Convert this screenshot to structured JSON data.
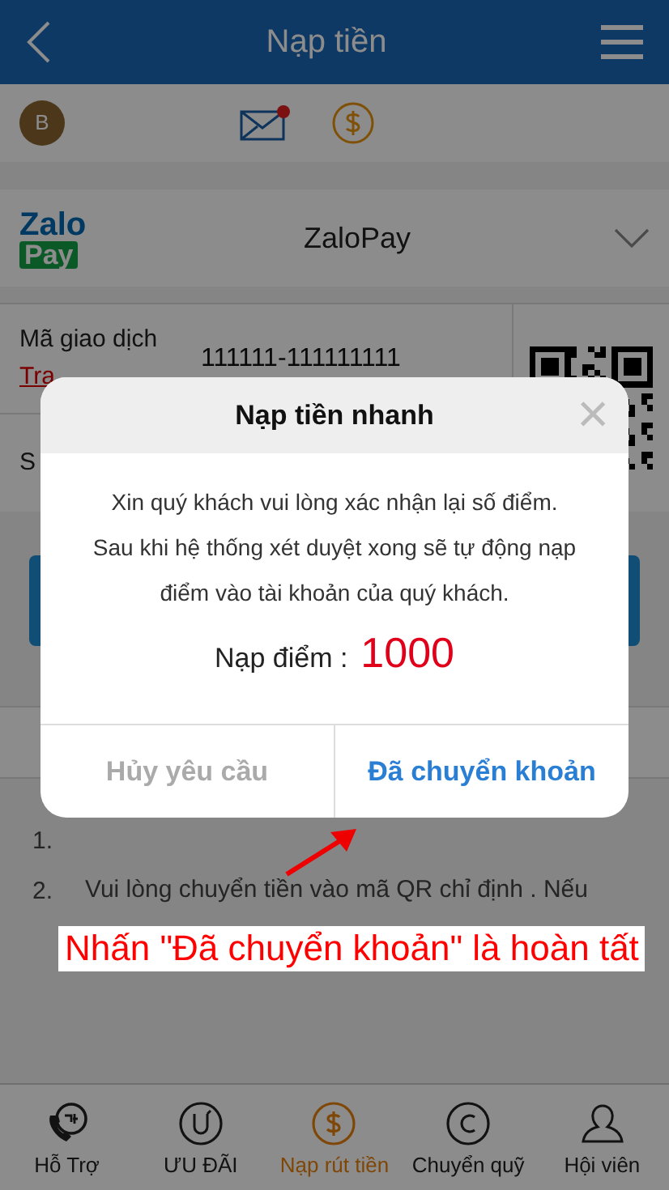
{
  "header": {
    "title": "Nạp tiền"
  },
  "user": {
    "avatar": "B",
    "has_mail": true
  },
  "payment": {
    "name": "ZaloPay",
    "logo_top": "Zalo",
    "logo_bottom": "Pay"
  },
  "transaction": {
    "label": "Mã giao dịch",
    "link": "Tra",
    "value": "111111-111111111"
  },
  "row_2": {
    "label": "S"
  },
  "notes": [
    {
      "number": "1."
    },
    {
      "number": "2.",
      "text": "Vui lòng chuyển tiền vào mã QR chỉ định . Nếu"
    }
  ],
  "modal": {
    "title": "Nạp tiền nhanh",
    "close": "×",
    "message": "Xin quý khách vui lòng xác nhận lại số điểm. Sau khi hệ thống xét duyệt xong sẽ tự động nạp điểm vào tài khoản của quý khách.",
    "points_label": "Nạp điểm :",
    "points": "1000",
    "buttons": [
      {
        "label": "Hủy yêu cầu",
        "kind": "cancel"
      },
      {
        "label": "Đã chuyển khoản",
        "kind": "confirm"
      }
    ]
  },
  "annotation": "Nhấn \"Đã chuyển khoản\" là hoàn tất",
  "nav": [
    {
      "label": "Hỗ Trợ",
      "selected": false
    },
    {
      "label": "ƯU ĐÃI",
      "selected": false
    },
    {
      "label": "Nạp rút tiền",
      "selected": true
    },
    {
      "label": "Chuyển quỹ",
      "selected": false
    },
    {
      "label": "Hội viên",
      "selected": false
    }
  ]
}
